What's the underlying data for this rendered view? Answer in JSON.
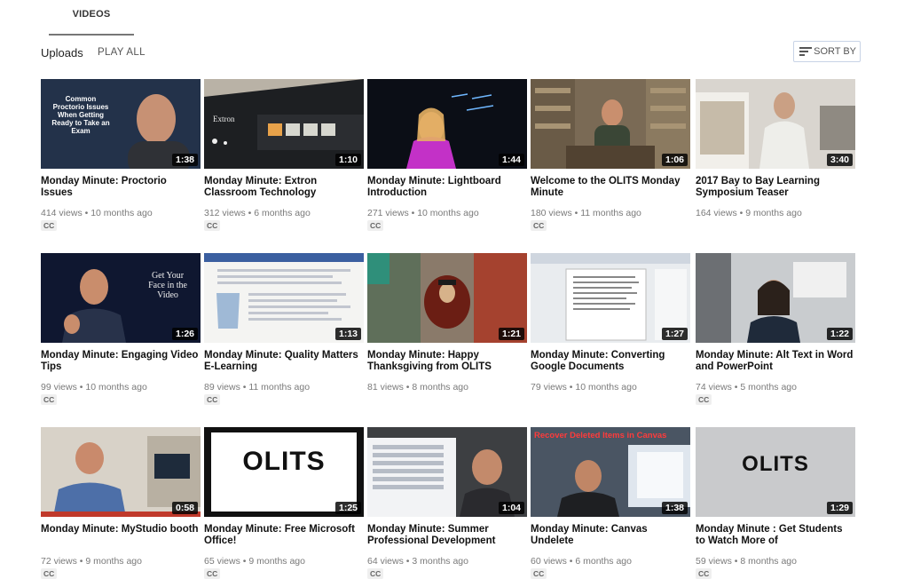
{
  "tabs": {
    "active_label": "VIDEOS"
  },
  "section": {
    "title": "Uploads",
    "play_all": "PLAY ALL",
    "sort_label": "SORT BY"
  },
  "videos": [
    {
      "title": "Monday Minute: Proctorio Issues",
      "meta": "414 views • 10 months ago",
      "cc": "CC",
      "duration": "1:38",
      "thumb_text": "Common Proctorio Issues When Getting Ready to Take an Exam"
    },
    {
      "title": "Monday Minute: Extron Classroom Technology",
      "meta": "312 views • 6 months ago",
      "cc": "CC",
      "duration": "1:10",
      "thumb_text": "Extron"
    },
    {
      "title": "Monday Minute: Lightboard Introduction",
      "meta": "271 views • 10 months ago",
      "cc": "CC",
      "duration": "1:44"
    },
    {
      "title": "Welcome to the OLITS Monday Minute",
      "meta": "180 views • 11 months ago",
      "cc": "CC",
      "duration": "1:06"
    },
    {
      "title": "2017 Bay to Bay Learning Symposium Teaser",
      "meta": "164 views • 9 months ago",
      "cc": "",
      "duration": "3:40"
    },
    {
      "title": "Monday Minute: Engaging Video Tips",
      "meta": "99 views • 10 months ago",
      "cc": "CC",
      "duration": "1:26",
      "thumb_text": "Get Your Face in the Video"
    },
    {
      "title": "Monday Minute: Quality Matters E-Learning",
      "meta": "89 views • 11 months ago",
      "cc": "CC",
      "duration": "1:13"
    },
    {
      "title": "Monday Minute: Happy Thanksgiving from OLITS",
      "meta": "81 views • 8 months ago",
      "cc": "",
      "duration": "1:21"
    },
    {
      "title": "Monday Minute: Converting Google Documents",
      "meta": "79 views • 10 months ago",
      "cc": "",
      "duration": "1:27"
    },
    {
      "title": "Monday Minute: Alt Text in Word and PowerPoint",
      "meta": "74 views • 5 months ago",
      "cc": "CC",
      "duration": "1:22"
    },
    {
      "title": "Monday Minute: MyStudio booth",
      "meta": "72 views • 9 months ago",
      "cc": "CC",
      "duration": "0:58"
    },
    {
      "title": "Monday Minute: Free Microsoft Office!",
      "meta": "65 views • 9 months ago",
      "cc": "CC",
      "duration": "1:25",
      "thumb_text": "OLITS"
    },
    {
      "title": "Monday Minute: Summer Professional Development",
      "meta": "64 views • 3 months ago",
      "cc": "CC",
      "duration": "1:04"
    },
    {
      "title": "Monday Minute: Canvas Undelete",
      "meta": "60 views • 6 months ago",
      "cc": "CC",
      "duration": "1:38",
      "thumb_text": "Recover Deleted Items in Canvas"
    },
    {
      "title": "Monday Minute : Get Students to Watch More of",
      "meta": "59 views • 8 months ago",
      "cc": "CC",
      "duration": "1:29",
      "thumb_text": "OLITS"
    }
  ]
}
